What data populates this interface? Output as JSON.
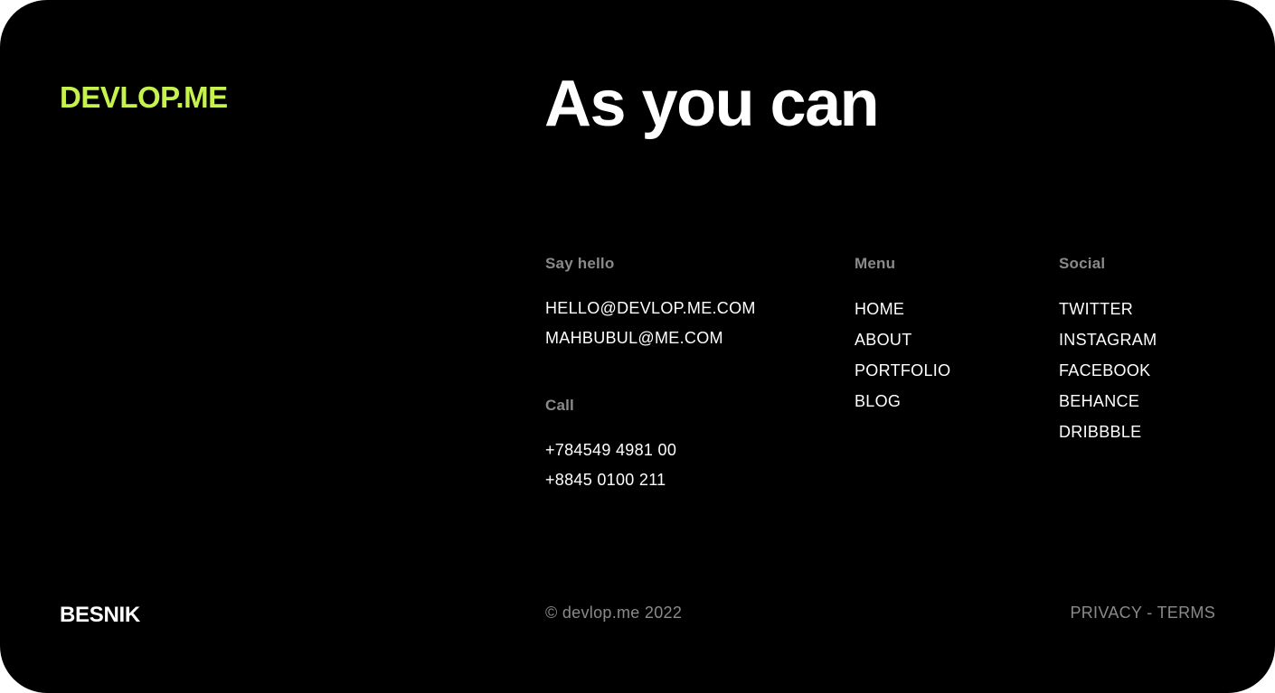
{
  "logo": "DEVLOP.ME",
  "headline": "As you can",
  "contact": {
    "hello_title": "Say hello",
    "emails": [
      "HELLO@DEVLOP.ME.COM",
      "MAHBUBUL@ME.COM"
    ],
    "call_title": "Call",
    "phones": [
      "+784549 4981 00",
      "+8845 0100 211"
    ]
  },
  "menu": {
    "title": "Menu",
    "items": [
      "HOME",
      "ABOUT",
      "PORTFOLIO",
      "BLOG"
    ]
  },
  "social": {
    "title": "Social",
    "items": [
      "TWITTER",
      "INSTAGRAM",
      "FACEBOOK",
      "BEHANCE",
      "DRIBBBLE"
    ]
  },
  "footer": {
    "brand": "BESNIK",
    "copyright": "© devlop.me 2022",
    "privacy": "PRIVACY",
    "separator": " - ",
    "terms": "TERMS"
  },
  "colors": {
    "background": "#000000",
    "accent": "#c6f24e",
    "text": "#ffffff",
    "muted": "#8a8a8a"
  }
}
